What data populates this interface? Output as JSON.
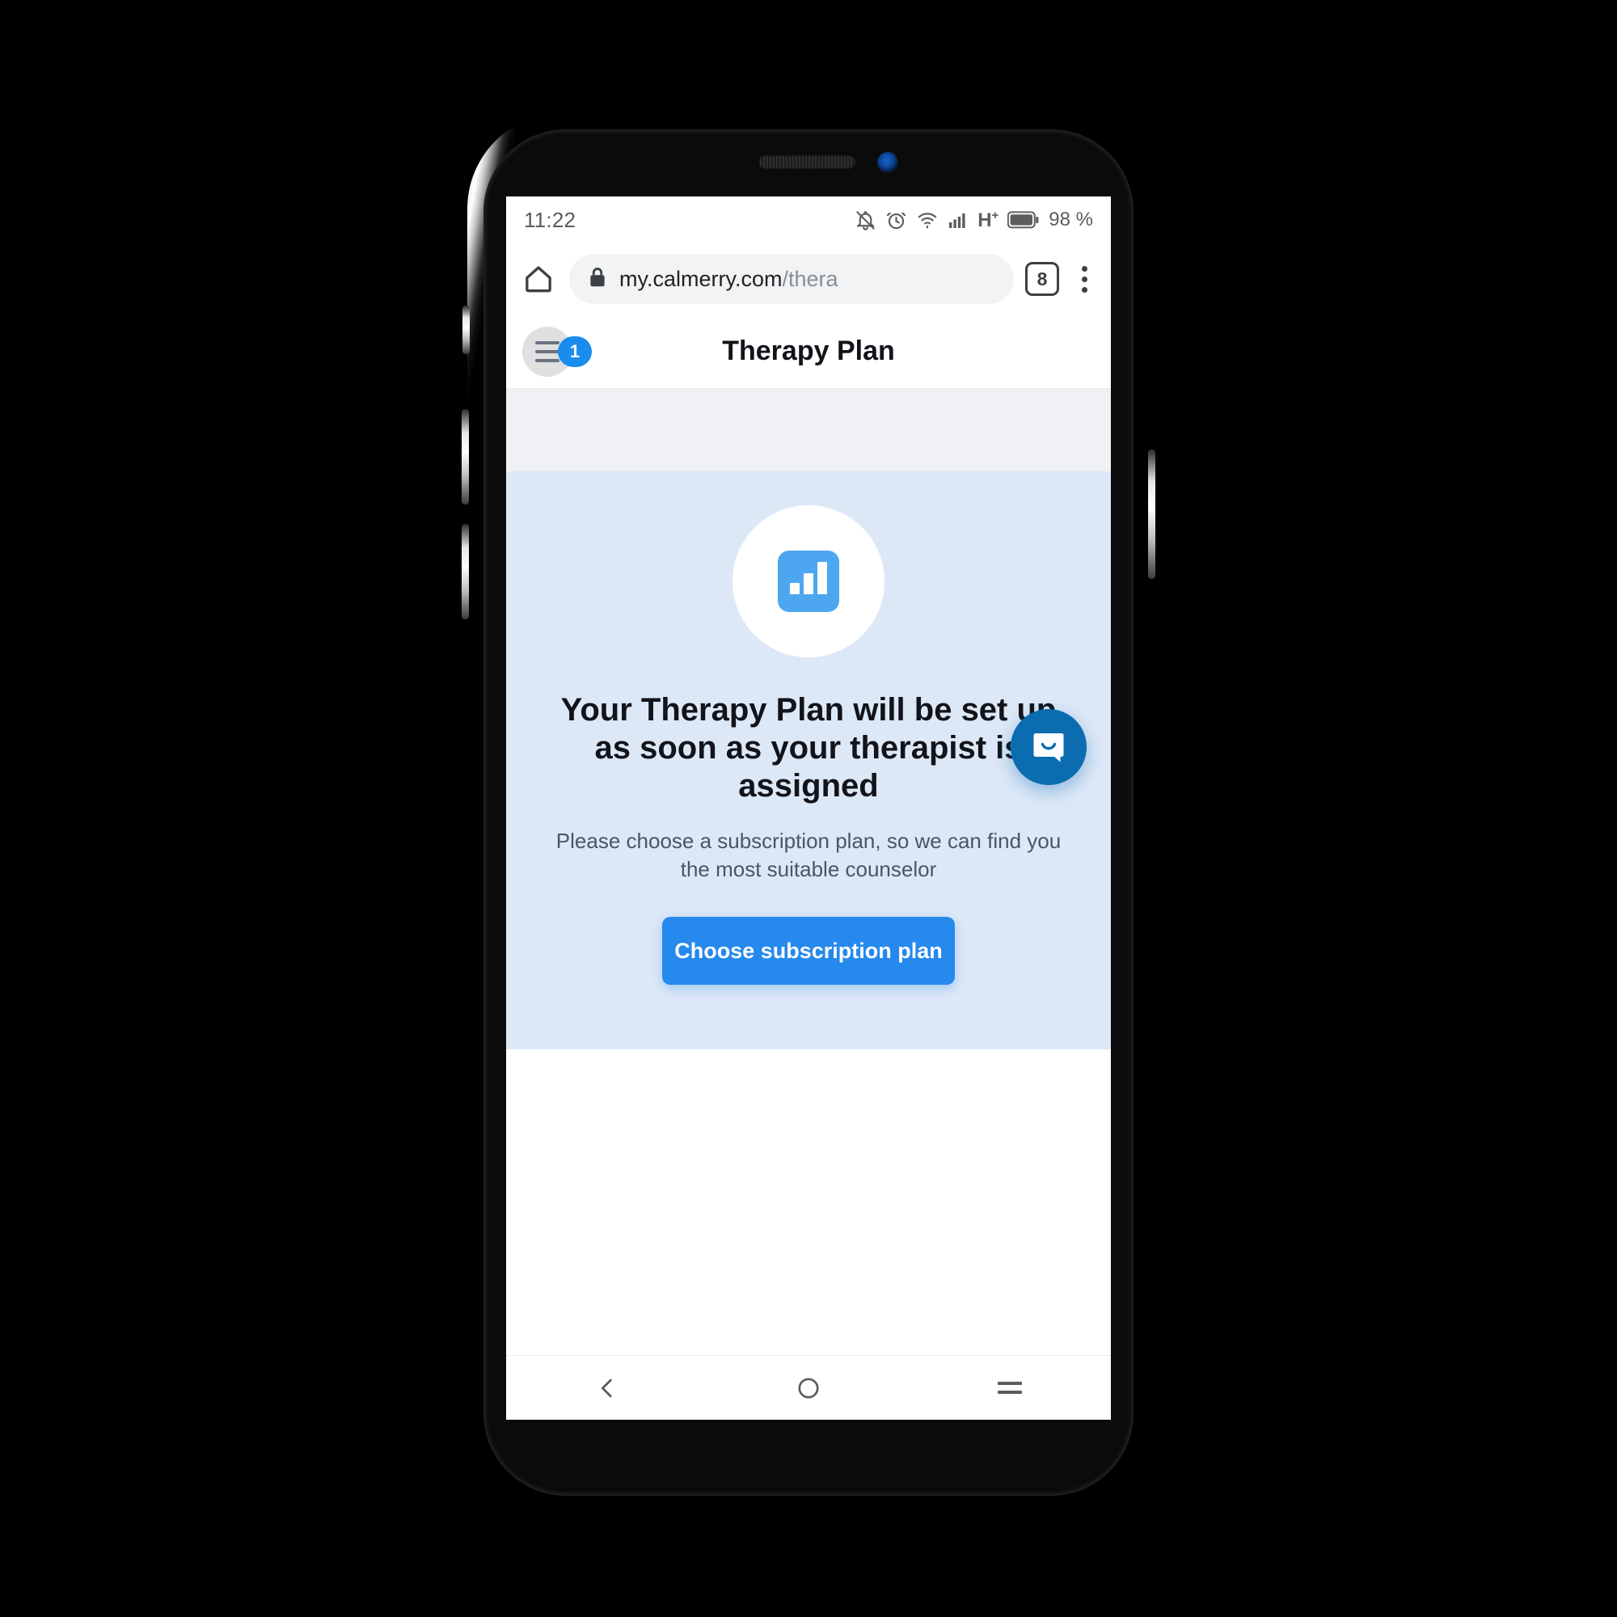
{
  "status_bar": {
    "time": "11:22",
    "battery_percent": "98 %",
    "network": "H",
    "network_sup": "+",
    "icons": [
      "bell-mute-icon",
      "alarm-clock-icon",
      "wifi-icon",
      "signal-bars-icon",
      "battery-icon"
    ]
  },
  "browser": {
    "url_host": "my.calmerry.com",
    "url_path": "/thera",
    "tab_count": "8",
    "icons": [
      "home-icon",
      "lock-icon",
      "tab-switcher-icon",
      "overflow-menu-icon"
    ]
  },
  "app_header": {
    "title": "Therapy Plan",
    "notification_badge": "1",
    "menu_icon": "hamburger-menu-icon"
  },
  "main": {
    "illustration_icon": "bar-chart-icon",
    "headline": "Your Therapy Plan will be set up as soon as your therapist is assigned",
    "subcopy": "Please choose a subscription plan, so we can find you the most suitable counselor",
    "cta_label": "Choose subscription plan",
    "chat_widget_icon": "chat-bubble-smile-icon"
  },
  "nav_bar": {
    "back": "back-icon",
    "home": "home-circle-icon",
    "recents": "recents-icon"
  },
  "colors": {
    "accent_blue": "#2589ed",
    "badge_blue": "#1a8cf0",
    "icon_blue": "#4da6f0",
    "chat_blue": "#0b6cb0",
    "content_bg": "#dde8f7",
    "band_bg": "#eff1f4"
  }
}
